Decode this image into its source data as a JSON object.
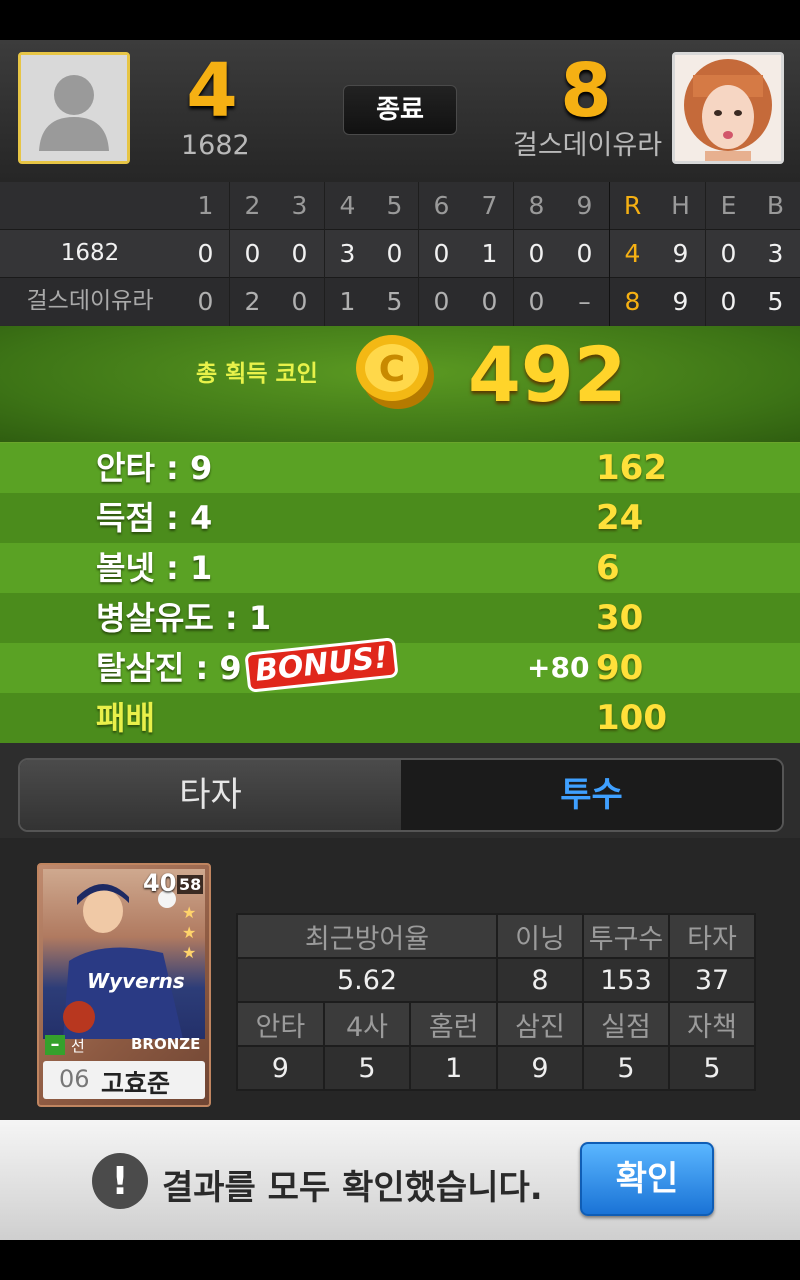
{
  "header": {
    "home_score": "4",
    "home_name": "1682",
    "status": "종료",
    "away_score": "8",
    "away_name": "걸스데이유라"
  },
  "scoreboard": {
    "columns": [
      "1",
      "2",
      "3",
      "4",
      "5",
      "6",
      "7",
      "8",
      "9",
      "R",
      "H",
      "E",
      "B"
    ],
    "rows": [
      {
        "team": "1682",
        "cells": [
          "0",
          "0",
          "0",
          "3",
          "0",
          "0",
          "1",
          "0",
          "0",
          "4",
          "9",
          "0",
          "3"
        ]
      },
      {
        "team": "걸스데이유라",
        "cells": [
          "0",
          "2",
          "0",
          "1",
          "5",
          "0",
          "0",
          "0",
          "–",
          "8",
          "9",
          "0",
          "5"
        ]
      }
    ]
  },
  "coins": {
    "label": "총 획득 코인",
    "total": "492"
  },
  "stats": [
    {
      "label": "안타 : 9",
      "value": "162",
      "extra": ""
    },
    {
      "label": "득점 : 4",
      "value": "24",
      "extra": ""
    },
    {
      "label": "볼넷 : 1",
      "value": "6",
      "extra": ""
    },
    {
      "label": "병살유도 : 1",
      "value": "30",
      "extra": ""
    },
    {
      "label": "탈삼진 : 9",
      "value": "90",
      "extra": "+80",
      "badge": "BONUS!"
    },
    {
      "label": "패배",
      "value": "100",
      "extra": ""
    }
  ],
  "tabs": {
    "batter": "타자",
    "pitcher": "투수",
    "active": "pitcher"
  },
  "player": {
    "overall": "40",
    "sub_rating": "58",
    "position": "선",
    "grade": "BRONZE",
    "number": "06",
    "name": "고효준",
    "jersey_text": "Wyverns"
  },
  "pitcher_stats": {
    "headers_top": [
      "최근방어율",
      "이닝",
      "투구수",
      "타자"
    ],
    "values_top": [
      "5.62",
      "8",
      "153",
      "37"
    ],
    "headers_bottom": [
      "안타",
      "4사",
      "홈런",
      "삼진",
      "실점",
      "자책"
    ],
    "values_bottom": [
      "9",
      "5",
      "1",
      "9",
      "5",
      "5"
    ]
  },
  "footer": {
    "message": "결과를 모두 확인했습니다.",
    "confirm": "확인",
    "alert_glyph": "!"
  },
  "colors": {
    "accent_orange": "#f5b013",
    "coin_yellow": "#ffd42a",
    "field_green": "#5aa224",
    "active_tab_blue": "#3fa0ff",
    "confirm_blue": "#1a73d6"
  }
}
